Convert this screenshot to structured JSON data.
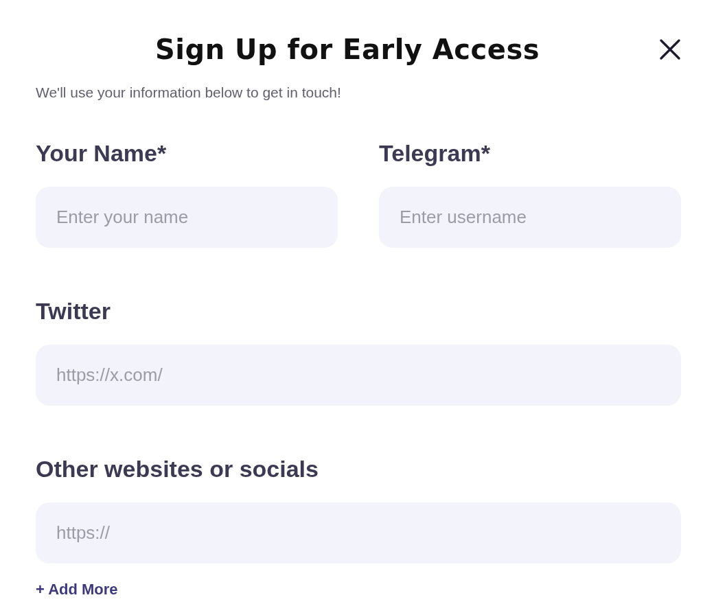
{
  "dialog": {
    "title": "Sign Up for Early Access",
    "subtitle": "We'll use your information below to get in touch!",
    "rows": [
      {
        "fields": [
          {
            "label": "Your Name*",
            "placeholder": "Enter your name"
          },
          {
            "label": "Telegram*",
            "placeholder": "Enter username"
          }
        ]
      },
      {
        "fields": [
          {
            "label": "Twitter",
            "placeholder": "https://x.com/"
          }
        ]
      },
      {
        "fields": [
          {
            "label": "Other websites or socials",
            "placeholder": "https://"
          }
        ]
      }
    ],
    "add_more": "+ Add More"
  }
}
